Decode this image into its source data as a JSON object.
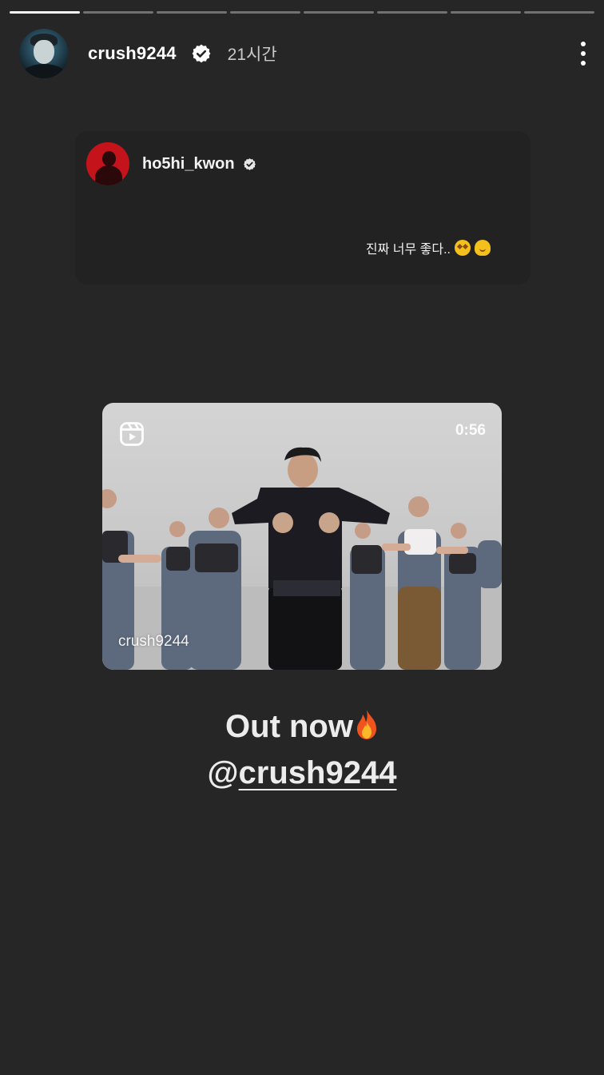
{
  "story": {
    "progress": {
      "segments": 8,
      "completed": 1
    },
    "header": {
      "username": "crush9244",
      "verified_icon": "verified-badge-icon",
      "time": "21시간",
      "more_icon": "more-vertical-icon"
    },
    "comment": {
      "username": "ho5hi_kwon",
      "verified_icon": "verified-badge-icon",
      "text": "진짜 너무 좋다..",
      "emojis": [
        "star-struck-emoji",
        "melting-face-emoji"
      ]
    },
    "reel": {
      "icon": "reels-icon",
      "duration": "0:56",
      "owner": "crush9244"
    },
    "caption": {
      "line1": "Out now",
      "line1_icon": "fire-emoji",
      "mention_at": "@",
      "mention": "crush9244"
    }
  }
}
